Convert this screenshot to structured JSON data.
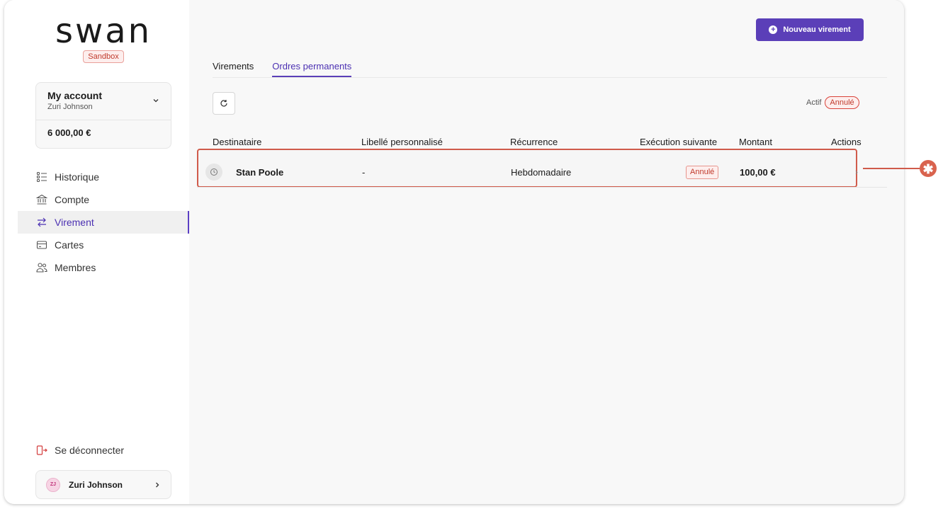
{
  "brand": {
    "logo": "swan",
    "env_badge": "Sandbox"
  },
  "account": {
    "title": "My account",
    "owner": "Zuri Johnson",
    "balance": "6 000,00 €"
  },
  "nav": {
    "items": [
      {
        "label": "Historique",
        "icon": "list-icon"
      },
      {
        "label": "Compte",
        "icon": "bank-icon"
      },
      {
        "label": "Virement",
        "icon": "transfer-icon",
        "active": true
      },
      {
        "label": "Cartes",
        "icon": "card-icon"
      },
      {
        "label": "Membres",
        "icon": "members-icon"
      }
    ]
  },
  "footer": {
    "logout_label": "Se déconnecter",
    "user_initials": "ZJ",
    "user_name": "Zuri Johnson"
  },
  "header": {
    "new_transfer_label": "Nouveau virement"
  },
  "tabs": [
    {
      "label": "Virements",
      "active": false
    },
    {
      "label": "Ordres permanents",
      "active": true
    }
  ],
  "filters": {
    "active_label": "Actif",
    "cancelled_label": "Annulé"
  },
  "table": {
    "columns": [
      "Destinataire",
      "Libellé personnalisé",
      "Récurrence",
      "Exécution suivante",
      "Montant",
      "Actions"
    ],
    "rows": [
      {
        "recipient": "Stan Poole",
        "label": "-",
        "recurrence": "Hebdomadaire",
        "next_execution": "Annulé",
        "amount": "100,00 €"
      }
    ]
  },
  "annotation": {
    "marker": "✱",
    "color": "#d9634e"
  }
}
